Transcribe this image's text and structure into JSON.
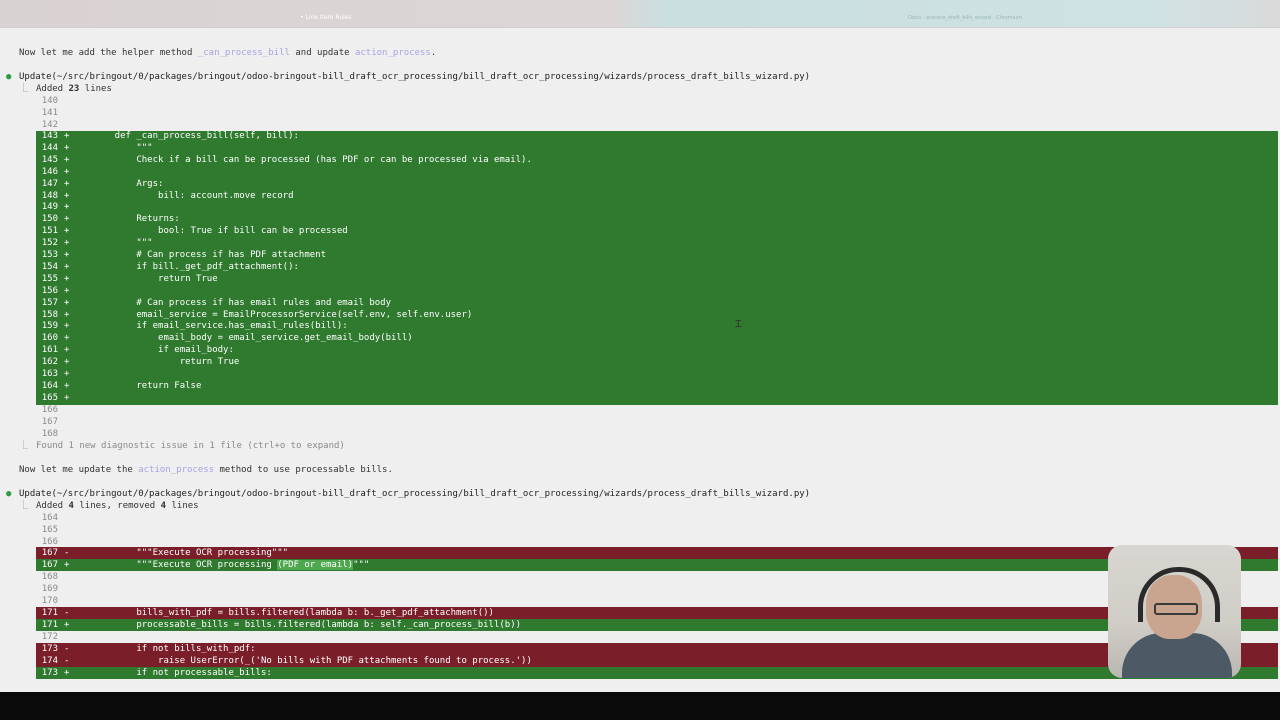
{
  "window": {
    "title_left": "• Line Item Rules",
    "title_right": "Odoo - process_draft_bills_wizard - Chromium"
  },
  "messages": {
    "intro": {
      "prefix": "Now let me add the helper method ",
      "ref1": "_can_process_bill",
      "mid": " and update ",
      "ref2": "action_process",
      "suffix": "."
    },
    "update1": {
      "label": "Update(~/src/bringout/0/packages/bringout/odoo-bringout-bill_draft_ocr_processing/bill_draft_ocr_processing/wizards/process_draft_bills_wizard.py)",
      "summary_prefix": "Added ",
      "summary_count": "23",
      "summary_suffix": " lines"
    },
    "diagnostic": "Found 1 new diagnostic issue in 1 file (ctrl+o to expand)",
    "second": {
      "prefix": "Now let me update the ",
      "ref": "action_process",
      "suffix": " method to use processable bills."
    },
    "update2": {
      "label": "Update(~/src/bringout/0/packages/bringout/odoo-bringout-bill_draft_ocr_processing/bill_draft_ocr_processing/wizards/process_draft_bills_wizard.py)",
      "summary_prefix": "Added ",
      "summary_count": "4",
      "summary_mid": " lines, removed ",
      "summary_count2": "4",
      "summary_suffix": " lines"
    }
  },
  "diff1": {
    "context_before": [
      "140",
      "141",
      "142"
    ],
    "added_lines": [
      {
        "num": "143",
        "code": "    def _can_process_bill(self, bill):"
      },
      {
        "num": "144",
        "code": "        \"\"\""
      },
      {
        "num": "145",
        "code": "        Check if a bill can be processed (has PDF or can be processed via email)."
      },
      {
        "num": "146",
        "code": ""
      },
      {
        "num": "147",
        "code": "        Args:"
      },
      {
        "num": "148",
        "code": "            bill: account.move record"
      },
      {
        "num": "149",
        "code": ""
      },
      {
        "num": "150",
        "code": "        Returns:"
      },
      {
        "num": "151",
        "code": "            bool: True if bill can be processed"
      },
      {
        "num": "152",
        "code": "        \"\"\""
      },
      {
        "num": "153",
        "code": "        # Can process if has PDF attachment"
      },
      {
        "num": "154",
        "code": "        if bill._get_pdf_attachment():"
      },
      {
        "num": "155",
        "code": "            return True"
      },
      {
        "num": "156",
        "code": ""
      },
      {
        "num": "157",
        "code": "        # Can process if has email rules and email body"
      },
      {
        "num": "158",
        "code": "        email_service = EmailProcessorService(self.env, self.env.user)"
      },
      {
        "num": "159",
        "code": "        if email_service.has_email_rules(bill):"
      },
      {
        "num": "160",
        "code": "            email_body = email_service.get_email_body(bill)"
      },
      {
        "num": "161",
        "code": "            if email_body:"
      },
      {
        "num": "162",
        "code": "                return True"
      },
      {
        "num": "163",
        "code": ""
      },
      {
        "num": "164",
        "code": "        return False"
      },
      {
        "num": "165",
        "code": ""
      }
    ],
    "context_after": [
      "166",
      "167",
      "168"
    ]
  },
  "diff2": {
    "ctx_a": [
      "164",
      "165",
      "166"
    ],
    "r167": {
      "num": "167",
      "code": "        \"\"\"Execute OCR processing\"\"\""
    },
    "a167": {
      "num": "167",
      "code_pre": "        \"\"\"Execute OCR processing ",
      "code_hl": "(PDF or email)",
      "code_post": "\"\"\""
    },
    "ctx_b": [
      "168",
      "169",
      "170"
    ],
    "r171": {
      "num": "171",
      "code": "        bills_with_pdf = bills.filtered(lambda b: b._get_pdf_attachment())"
    },
    "a171": {
      "num": "171",
      "code": "        processable_bills = bills.filtered(lambda b: self._can_process_bill(b))"
    },
    "ctx_c": [
      "172"
    ],
    "r173": {
      "num": "173",
      "code": "        if not bills_with_pdf:"
    },
    "r174": {
      "num": "174",
      "code": "            raise UserError(_('No bills with PDF attachments found to process.'))"
    },
    "a173": {
      "num": "173",
      "code": "        if not processable_bills:"
    }
  },
  "markers": {
    "add": "+",
    "remove": "-",
    "dot": "●",
    "elbow": "⎿"
  },
  "colors": {
    "added_bg": "#2f7a2f",
    "removed_bg": "#7a1f2a",
    "highlight_bg": "#4fa84f",
    "ref_text": "#a6a3e6"
  }
}
